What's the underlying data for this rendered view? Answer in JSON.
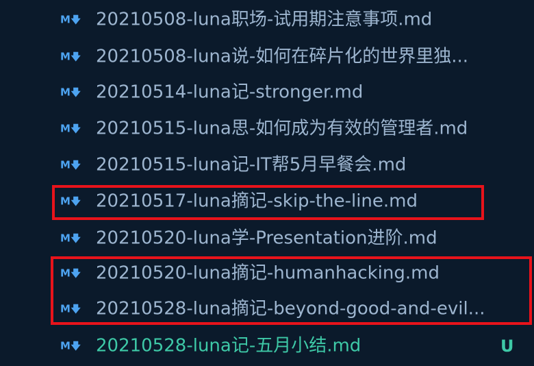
{
  "explorer": {
    "icon_label": "M",
    "files": [
      {
        "name": "20210508-luna职场-试用期注意事项.md",
        "badge": ""
      },
      {
        "name": "20210508-luna说-如何在碎片化的世界里独...",
        "badge": ""
      },
      {
        "name": "20210514-luna记-stronger.md",
        "badge": ""
      },
      {
        "name": "20210515-luna思-如何成为有效的管理者.md",
        "badge": ""
      },
      {
        "name": "20210515-luna记-IT帮5月早餐会.md",
        "badge": ""
      },
      {
        "name": "20210517-luna摘记-skip-the-line.md",
        "badge": ""
      },
      {
        "name": "20210520-luna学-Presentation进阶.md",
        "badge": ""
      },
      {
        "name": "20210520-luna摘记-humanhacking.md",
        "badge": ""
      },
      {
        "name": "20210528-luna摘记-beyond-good-and-evil...",
        "badge": ""
      },
      {
        "name": "20210528-luna记-五月小结.md",
        "badge": "U"
      }
    ]
  },
  "colors": {
    "background": "#0b1a2b",
    "file_text": "#9db5cf",
    "markdown_icon": "#4da3f0",
    "untracked": "#3ec9a7",
    "highlight_border": "#e8131b"
  }
}
